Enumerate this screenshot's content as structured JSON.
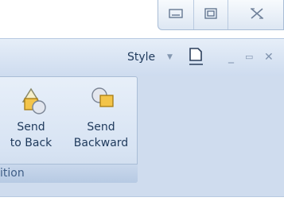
{
  "window": {
    "minimize_glyph": "▭",
    "maximize_glyph": "▣",
    "close_glyph": "☒"
  },
  "ribbon": {
    "style_label": "Style",
    "style_dropdown_glyph": "▼",
    "restore_glyph": "▭",
    "min_glyph": "_",
    "close_glyph": "✕"
  },
  "group": {
    "label": "ition",
    "commands": [
      {
        "line1": "Send",
        "line2": "to Back",
        "icon": "send-to-back-icon"
      },
      {
        "line1": "Send",
        "line2": "Backward",
        "icon": "send-backward-icon"
      }
    ]
  },
  "colors": {
    "ribbon_bg": "#cfdcee",
    "text": "#1e395b",
    "group_border": "#a9bdd6"
  }
}
